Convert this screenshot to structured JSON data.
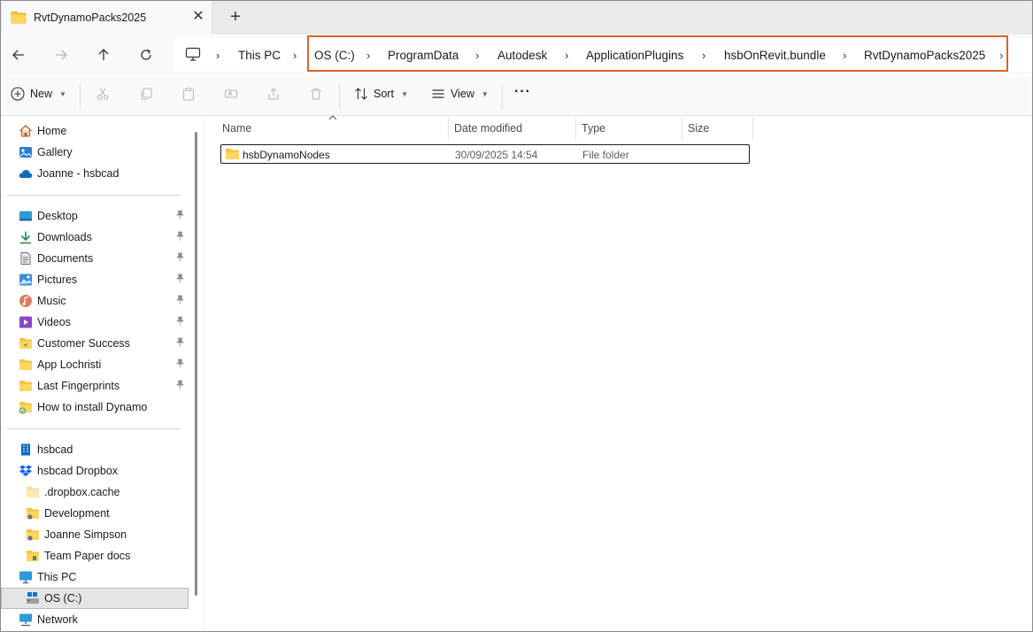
{
  "window": {
    "tab_title": "RvtDynamoPacks2025",
    "close_glyph": "✕",
    "new_tab_glyph": "+"
  },
  "nav": {
    "back_icon": "arrow-left-icon",
    "forward_icon": "arrow-right-icon",
    "up_icon": "arrow-up-icon",
    "refresh_icon": "refresh-icon"
  },
  "breadcrumb": {
    "separator": "›",
    "items": [
      "This PC",
      "OS (C:)",
      "ProgramData",
      "Autodesk",
      "ApplicationPlugins",
      "hsbOnRevit.bundle",
      "RvtDynamoPacks2025"
    ]
  },
  "commands": {
    "new_label": "New",
    "sort_label": "Sort",
    "view_label": "View",
    "more_label": "···"
  },
  "sidebar": {
    "top": [
      {
        "label": "Home",
        "icon": "home-icon"
      },
      {
        "label": "Gallery",
        "icon": "gallery-icon"
      },
      {
        "label": "Joanne - hsbcad",
        "icon": "cloud-icon"
      }
    ],
    "pinned": [
      {
        "label": "Desktop",
        "icon": "desktop-icon"
      },
      {
        "label": "Downloads",
        "icon": "download-icon"
      },
      {
        "label": "Documents",
        "icon": "documents-icon"
      },
      {
        "label": "Pictures",
        "icon": "pictures-icon"
      },
      {
        "label": "Music",
        "icon": "music-icon"
      },
      {
        "label": "Videos",
        "icon": "videos-icon"
      },
      {
        "label": "Customer Success",
        "icon": "folder-icon"
      },
      {
        "label": "App Lochristi",
        "icon": "folder-icon"
      },
      {
        "label": "Last Fingerprints",
        "icon": "folder-icon"
      },
      {
        "label": "How to install Dynamo",
        "icon": "folder-icon"
      }
    ],
    "drives": [
      {
        "label": "hsbcad",
        "icon": "building-icon"
      },
      {
        "label": "hsbcad Dropbox",
        "icon": "dropbox-icon"
      },
      {
        "label": ".dropbox.cache",
        "icon": "folder-icon"
      },
      {
        "label": "Development",
        "icon": "folder-icon"
      },
      {
        "label": "Joanne Simpson",
        "icon": "folder-icon"
      },
      {
        "label": "Team Paper docs",
        "icon": "folder-icon"
      },
      {
        "label": "This PC",
        "icon": "pc-icon"
      },
      {
        "label": "OS (C:)",
        "icon": "drive-icon"
      },
      {
        "label": "Network",
        "icon": "network-icon"
      }
    ],
    "pin_glyph": "📌"
  },
  "columns": [
    "Name",
    "Date modified",
    "Type",
    "Size"
  ],
  "files": [
    {
      "name": "hsbDynamoNodes",
      "date": "30/09/2025 14:54",
      "type": "File folder",
      "size": ""
    }
  ],
  "colors": {
    "highlight": "#d9642a",
    "folder": "#f5c342",
    "accent": "#0067c0"
  }
}
